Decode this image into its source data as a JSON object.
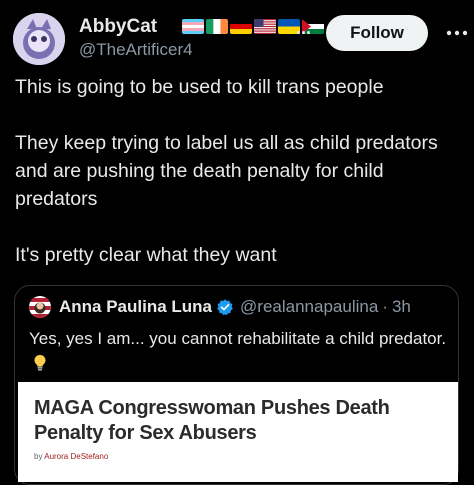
{
  "author": {
    "display_name": "AbbyCat",
    "handle": "@TheArtificer4",
    "name_overflow": "...",
    "avatar_icon": "avatar-art-icon",
    "flags": [
      "transgender-flag-icon",
      "ireland-flag-icon",
      "germany-flag-icon",
      "usa-flag-icon",
      "ukraine-flag-icon",
      "palestine-flag-icon"
    ]
  },
  "actions": {
    "follow_label": "Follow",
    "more_icon": "more-dots-icon"
  },
  "tweet": {
    "lines": [
      "This is going to be used to kill trans people",
      "They keep trying to label us all as child predators and are pushing the death penalty for child predators",
      "It's pretty clear what they want"
    ]
  },
  "quote": {
    "display_name": "Anna Paulina Luna",
    "handle": "@realannapaulina",
    "separator": "·",
    "time": "3h",
    "text": "Yes, yes I am... you cannot rehabilitate a child predator.",
    "verified_icon": "verified-badge-icon",
    "emoji_icon": "light-bulb-icon",
    "article": {
      "title": "MAGA Congresswoman Pushes Death Penalty for Sex Abusers",
      "byline_prefix": "by",
      "byline_author": "Aurora DeStefano"
    }
  },
  "colors": {
    "background": "#000000",
    "text": "#e7e9ea",
    "secondary_text": "#8b98a5",
    "verified": "#1d9bf0",
    "follow_bg": "#eff3f4"
  }
}
